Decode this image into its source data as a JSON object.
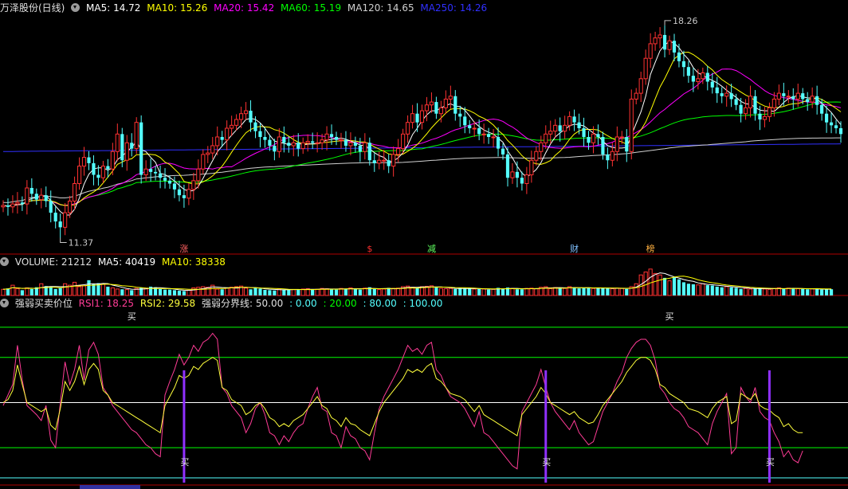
{
  "header_main": {
    "stock_name": "万泽股份(日线)",
    "ma5": "MA5: 14.72",
    "ma10": "MA10: 15.26",
    "ma20": "MA20: 15.42",
    "ma60": "MA60: 15.19",
    "ma120": "MA120: 14.65",
    "ma250": "MA250: 14.26"
  },
  "header_volume": {
    "volume": "VOLUME: 21212",
    "ma5": "MA5: 40419",
    "ma10": "MA10: 38338"
  },
  "header_indicator": {
    "name": "强弱买卖价位",
    "rsi1": "RSI1: 18.25",
    "rsi2": "RSI2: 29.58",
    "levels_label": "强弱分界线: 50.00",
    "l0": ": 0.00",
    "l20": ": 20.00",
    "l80": ": 80.00",
    "l100": ": 100.00"
  },
  "colors": {
    "up": "#ff3232",
    "down": "#54ffff",
    "ma5": "#ffffff",
    "ma10": "#ffff00",
    "ma20": "#ff00ff",
    "ma60": "#00ff00",
    "ma120": "#d0d0d0",
    "ma250": "#3030ff",
    "panel_border": "#b00000",
    "buy_bar": "#9030ff"
  },
  "annotations": {
    "high_label": "18.26",
    "low_label": "11.37",
    "event_markers": [
      "涨",
      "$",
      "减",
      "财",
      "榜"
    ],
    "buy_label": "买"
  },
  "chart_data": [
    {
      "type": "candlestick",
      "title": "万泽股份(日线)",
      "x": [
        0,
        1,
        2,
        3,
        4,
        5,
        6,
        7,
        8,
        9,
        10,
        11,
        12,
        13,
        14,
        15,
        16,
        17,
        18,
        19,
        20,
        21,
        22,
        23,
        24,
        25,
        26,
        27,
        28,
        29,
        30,
        31,
        32,
        33,
        34,
        35,
        36,
        37,
        38,
        39,
        40,
        41,
        42,
        43,
        44,
        45,
        46,
        47,
        48,
        49,
        50,
        51,
        52,
        53,
        54,
        55,
        56,
        57,
        58,
        59,
        60,
        61,
        62,
        63,
        64,
        65,
        66,
        67,
        68,
        69,
        70,
        71,
        72,
        73,
        74,
        75,
        76,
        77,
        78,
        79,
        80,
        81,
        82,
        83,
        84,
        85,
        86,
        87,
        88,
        89,
        90,
        91,
        92,
        93,
        94,
        95,
        96,
        97,
        98,
        99,
        100,
        101,
        102,
        103,
        104,
        105,
        106,
        107,
        108,
        109,
        110,
        111,
        112,
        113,
        114,
        115,
        116,
        117,
        118,
        119,
        120,
        121,
        122,
        123,
        124,
        125,
        126,
        127,
        128,
        129,
        130,
        131,
        132,
        133,
        134,
        135,
        136,
        137,
        138,
        139,
        140,
        141,
        142,
        143,
        144,
        145,
        146,
        147,
        148,
        149,
        150,
        151,
        152,
        153,
        154,
        155,
        156,
        157,
        158,
        159,
        160,
        161,
        162,
        163,
        164,
        165,
        166,
        167,
        168,
        169,
        170,
        171,
        172,
        173,
        174
      ],
      "close": [
        12.15,
        12.1,
        12.2,
        12.25,
        12.2,
        12.75,
        12.55,
        12.35,
        12.5,
        12.3,
        11.9,
        11.6,
        11.4,
        11.9,
        12.3,
        12.9,
        13.5,
        13.8,
        13.6,
        13.2,
        13.1,
        13.5,
        13.4,
        14.0,
        14.6,
        13.7,
        14.3,
        14.1,
        15.0,
        13.2,
        13.4,
        13.3,
        13.25,
        13.1,
        13.0,
        12.9,
        12.7,
        12.5,
        12.4,
        12.7,
        13.0,
        13.4,
        13.9,
        13.95,
        14.2,
        14.5,
        14.4,
        14.8,
        14.9,
        15.1,
        15.3,
        15.4,
        15.0,
        14.7,
        14.5,
        14.4,
        14.2,
        14.0,
        14.5,
        14.3,
        14.2,
        14.3,
        14.1,
        14.3,
        14.35,
        14.3,
        14.3,
        14.4,
        14.6,
        14.5,
        14.4,
        14.4,
        14.2,
        14.3,
        14.2,
        14.0,
        14.3,
        13.7,
        13.6,
        13.7,
        13.7,
        13.5,
        13.9,
        14.1,
        14.6,
        15.0,
        15.3,
        15.0,
        15.4,
        15.6,
        15.7,
        15.3,
        15.5,
        15.8,
        15.9,
        15.3,
        15.2,
        14.9,
        14.8,
        14.8,
        14.6,
        14.6,
        14.5,
        14.5,
        14.1,
        13.9,
        13.1,
        13.3,
        13.1,
        12.9,
        13.2,
        13.7,
        14.0,
        14.3,
        14.6,
        14.7,
        14.9,
        14.7,
        14.9,
        15.2,
        15.0,
        14.8,
        14.5,
        14.3,
        14.6,
        14.5,
        13.9,
        13.7,
        14.0,
        14.5,
        14.5,
        14.0,
        15.8,
        16.0,
        16.5,
        17.2,
        17.7,
        17.9,
        18.0,
        17.5,
        17.8,
        17.4,
        17.1,
        16.9,
        16.6,
        16.4,
        16.5,
        16.7,
        16.4,
        16.2,
        16.0,
        15.9,
        16.0,
        15.8,
        15.6,
        15.3,
        15.5,
        15.9,
        15.3,
        15.1,
        15.2,
        15.5,
        15.8,
        16.0,
        15.9,
        15.9,
        15.8,
        16.0,
        15.8,
        15.7,
        15.9,
        15.6,
        15.3,
        15.0,
        14.9,
        14.8,
        14.6
      ]
    },
    {
      "type": "bar",
      "title": "VOLUME",
      "values": [
        21000,
        24000,
        35000,
        23000,
        18000,
        26000,
        22000,
        28000,
        40000,
        32000,
        30000,
        22000,
        25000,
        40000,
        35000,
        45000,
        30000,
        33000,
        52000,
        38000,
        42000,
        40000,
        30000,
        26000,
        22000,
        21000,
        20000,
        18000,
        24000,
        26000,
        25000,
        30000,
        28000,
        22000,
        20000,
        20000,
        18000,
        16000,
        15000,
        18000,
        26000,
        28000,
        30000,
        28000,
        35000,
        22000,
        21000,
        25000,
        28000,
        30000,
        32000,
        25000,
        21000,
        26000,
        23000,
        19000,
        18000,
        17000,
        22000,
        20000,
        21000,
        20000,
        19000,
        22000,
        23000,
        20000,
        21000,
        24000,
        23000,
        22000,
        20000,
        24000,
        23000,
        26000,
        23000,
        20000,
        25000,
        28000,
        22000,
        20000,
        22000,
        26000,
        24000,
        25000,
        30000,
        32000,
        28000,
        25000,
        30000,
        31000,
        33000,
        28000,
        24000,
        23000,
        24000,
        22000,
        25000,
        24000,
        24000,
        22000,
        22000,
        22000,
        20000,
        21000,
        26000,
        23000,
        27000,
        24000,
        21000,
        21000,
        24000,
        25000,
        23000,
        28000,
        30000,
        23000,
        27000,
        26000,
        24000,
        30000,
        27000,
        24000,
        25000,
        27000,
        24000,
        26000,
        25000,
        24000,
        23000,
        25000,
        24000,
        22000,
        30000,
        40000,
        70000,
        80000,
        90000,
        75000,
        70000,
        60000,
        50000,
        62000,
        55000,
        45000,
        40000,
        38000,
        36000,
        40000,
        35000,
        34000,
        30000,
        28000,
        30000,
        28000,
        26000,
        22000,
        24000,
        22000,
        24000,
        25000,
        22000,
        21000,
        24000,
        26000,
        23000,
        25000,
        24000,
        23000,
        22000,
        21000,
        23000,
        22000,
        20000,
        21000,
        21212
      ]
    },
    {
      "type": "line",
      "title": "强弱买卖价位",
      "series": [
        {
          "name": "RSI1",
          "values": [
            48,
            55,
            62,
            88,
            65,
            48,
            45,
            42,
            38,
            48,
            25,
            20,
            50,
            77,
            62,
            72,
            88,
            65,
            85,
            90,
            82,
            60,
            55,
            48,
            44,
            40,
            36,
            32,
            30,
            26,
            22,
            20,
            16,
            14,
            55,
            64,
            72,
            82,
            75,
            80,
            88,
            84,
            90,
            92,
            96,
            92,
            60,
            56,
            48,
            44,
            40,
            30,
            36,
            46,
            50,
            42,
            30,
            28,
            22,
            28,
            24,
            30,
            34,
            36,
            46,
            54,
            60,
            46,
            44,
            30,
            28,
            20,
            34,
            28,
            26,
            20,
            18,
            12,
            30,
            46,
            54,
            60,
            66,
            72,
            80,
            88,
            84,
            86,
            82,
            88,
            90,
            72,
            68,
            60,
            54,
            52,
            50,
            46,
            40,
            34,
            44,
            30,
            28,
            24,
            20,
            16,
            12,
            8,
            6,
            44,
            50,
            56,
            62,
            72,
            60,
            50,
            44,
            40,
            36,
            32,
            38,
            30,
            26,
            22,
            24,
            34,
            44,
            50,
            56,
            64,
            70,
            80,
            86,
            90,
            92,
            92,
            88,
            78,
            60,
            56,
            50,
            46,
            44,
            40,
            34,
            32,
            30,
            26,
            22,
            36,
            44,
            50,
            56,
            16,
            20,
            60,
            54,
            50,
            60,
            44,
            40,
            38,
            30,
            24,
            14,
            18,
            12,
            10,
            18
          ],
          "color": "#ff3c96"
        },
        {
          "name": "RSI2",
          "values": [
            50,
            52,
            58,
            75,
            62,
            50,
            48,
            46,
            44,
            46,
            35,
            32,
            46,
            64,
            58,
            64,
            74,
            62,
            72,
            76,
            72,
            58,
            55,
            50,
            48,
            46,
            44,
            42,
            40,
            38,
            36,
            34,
            32,
            30,
            48,
            54,
            60,
            68,
            66,
            68,
            74,
            72,
            76,
            78,
            80,
            78,
            60,
            58,
            52,
            50,
            48,
            42,
            44,
            48,
            50,
            46,
            40,
            38,
            34,
            36,
            34,
            38,
            40,
            42,
            46,
            50,
            54,
            48,
            46,
            40,
            38,
            34,
            40,
            36,
            35,
            32,
            30,
            28,
            36,
            44,
            50,
            54,
            58,
            62,
            66,
            72,
            70,
            72,
            70,
            74,
            76,
            66,
            64,
            60,
            56,
            55,
            54,
            52,
            48,
            44,
            48,
            42,
            40,
            38,
            36,
            34,
            32,
            30,
            28,
            42,
            46,
            50,
            54,
            60,
            56,
            50,
            48,
            46,
            44,
            42,
            44,
            40,
            38,
            36,
            37,
            42,
            48,
            52,
            56,
            60,
            64,
            70,
            74,
            78,
            80,
            80,
            78,
            72,
            62,
            60,
            56,
            54,
            52,
            50,
            46,
            45,
            44,
            42,
            40,
            46,
            50,
            52,
            54,
            36,
            38,
            56,
            54,
            52,
            56,
            48,
            46,
            45,
            42,
            40,
            34,
            36,
            32,
            30,
            30
          ],
          "color": "#ffff3c"
        }
      ],
      "levels": [
        0,
        20,
        50,
        80,
        100
      ],
      "buy_signals_bottom": [
        38,
        114,
        161
      ],
      "buy_signals_top": [
        27,
        140
      ]
    }
  ]
}
